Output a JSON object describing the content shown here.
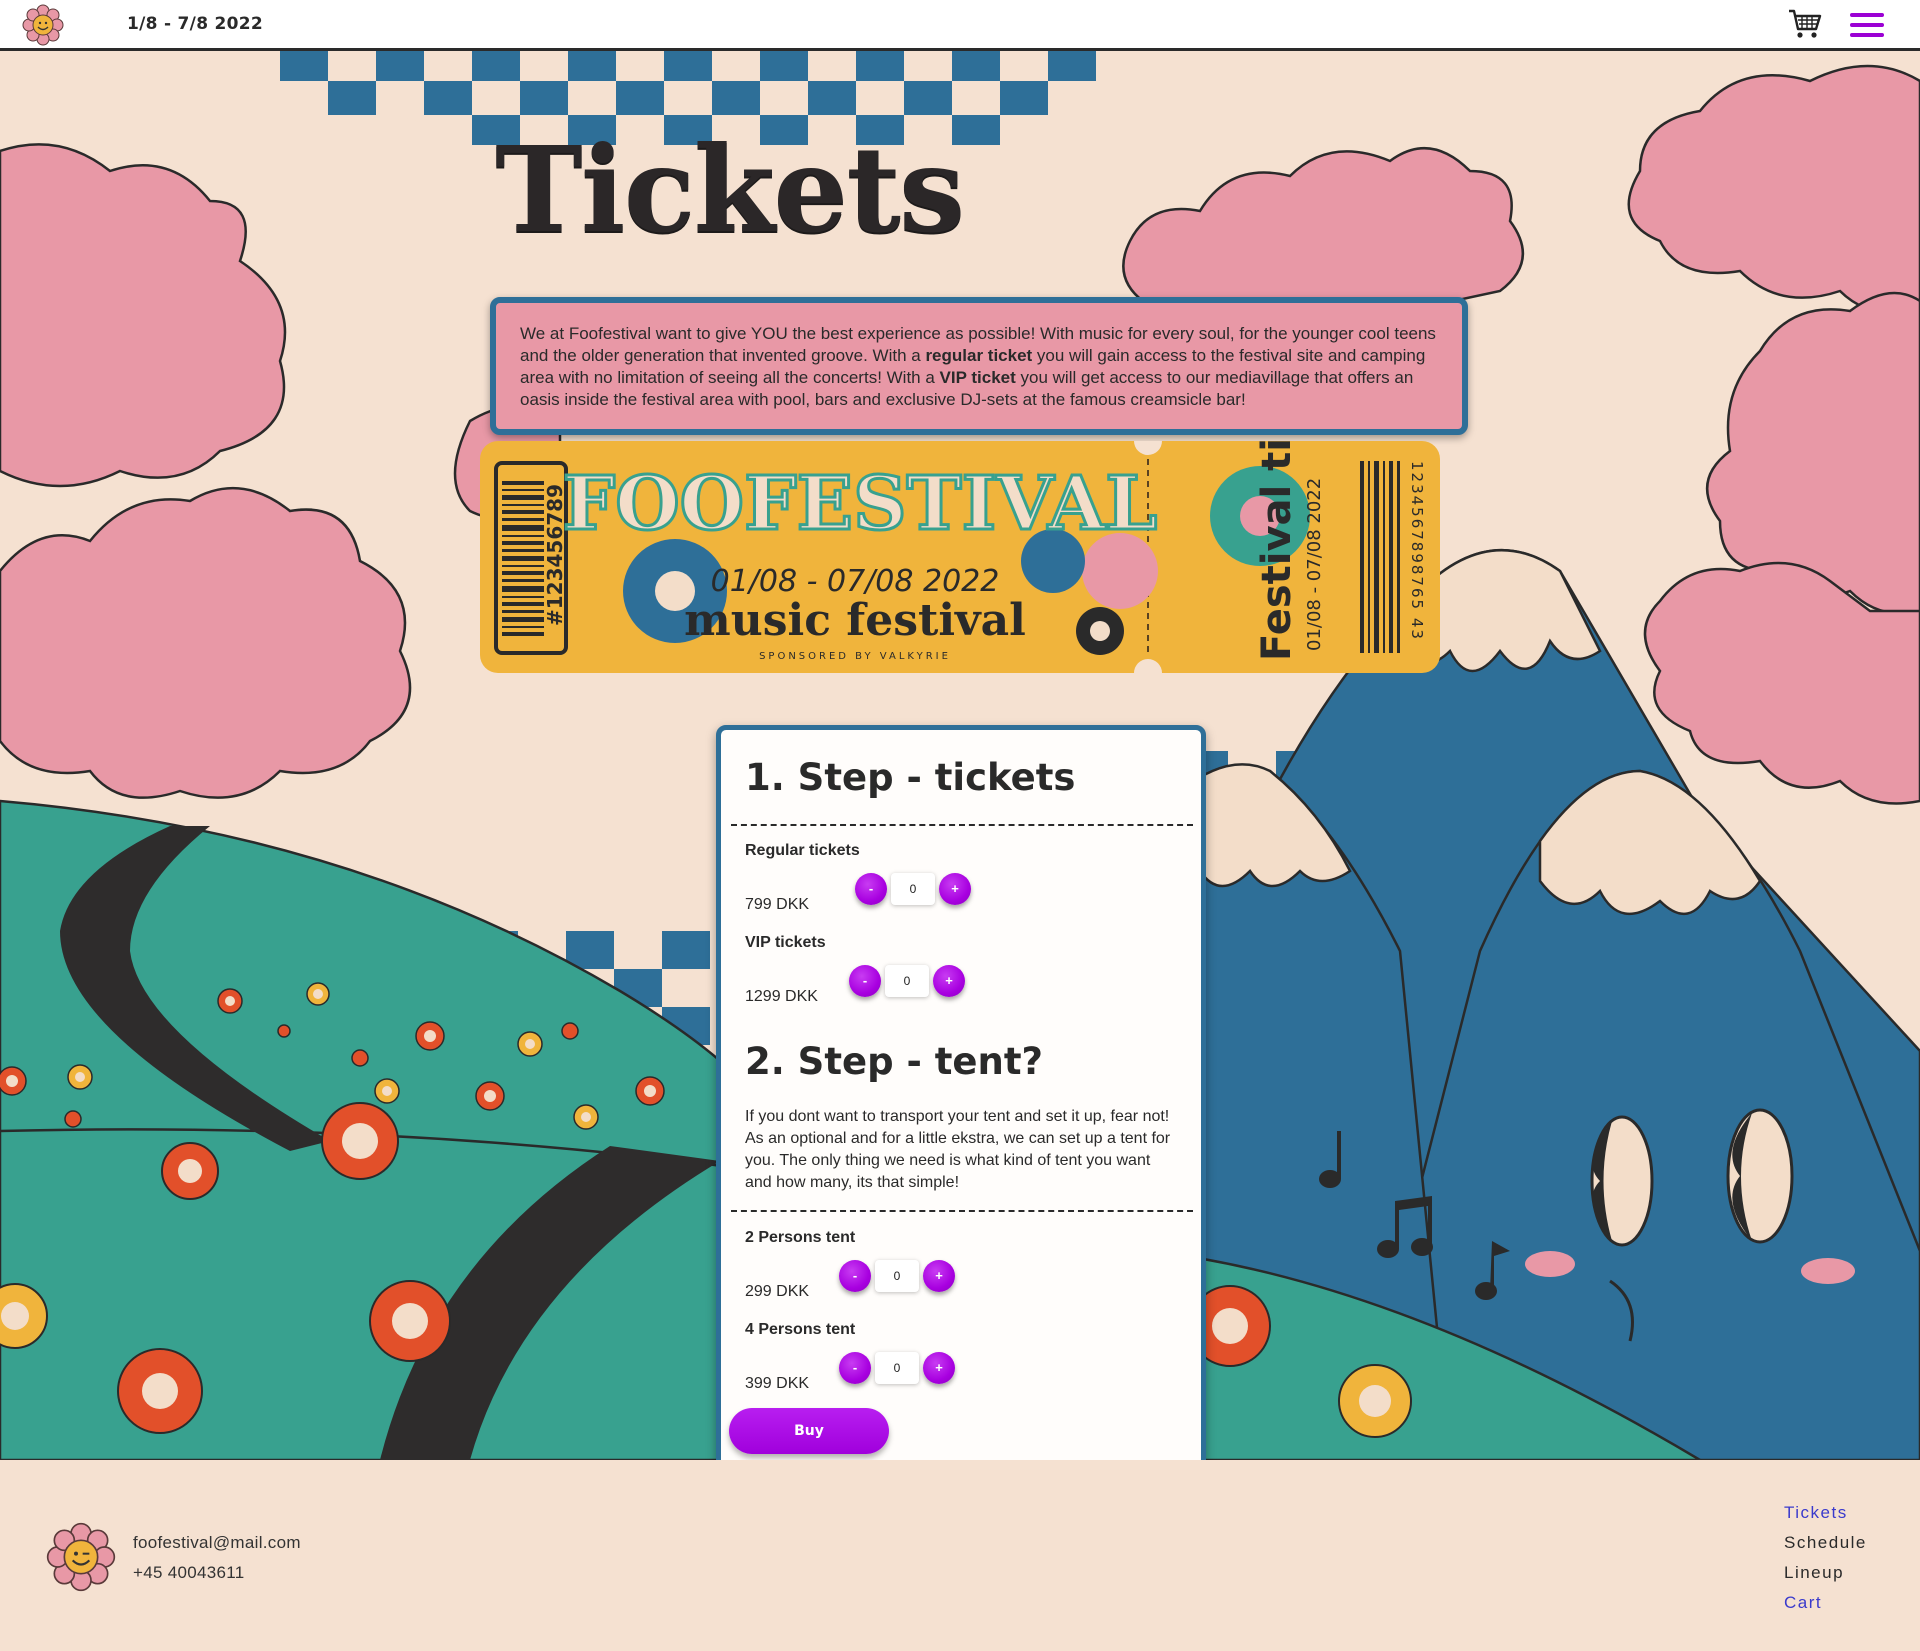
{
  "nav": {
    "dates": "1/8 - 7/8 2022",
    "logo_icon": "smiley-flower-icon",
    "cart_icon": "shopping-cart-icon",
    "menu_icon": "hamburger-menu-icon"
  },
  "page": {
    "title": "Tickets"
  },
  "intro": {
    "part1": "We at Foofestival want to give YOU the best experience as possible! With music for every soul, for the younger cool teens and the older generation that invented groove. With a ",
    "bold1": "regular ticket",
    "part2": " you will gain access to the festival site and camping area with no limitation of seeing all the concerts! With a ",
    "bold2": "VIP ticket",
    "part3": " you will get access to our mediavillage that offers an oasis inside the festival area with pool, bars and exclusive DJ-sets at the famous creamsicle bar!"
  },
  "ticket_graphic": {
    "stub_number": "#123456789",
    "festival_name": "FOOFESTIVAL",
    "dates": "01/08 - 07/08 2022",
    "subtitle": "music festival",
    "sponsor": "SPONSORED BY VALKYRIE",
    "side_title": "Festival ticket",
    "side_dates": "01/08 - 07/08 2022",
    "side_number": "1234567898765 43"
  },
  "step1": {
    "heading": "1. Step - tickets",
    "items": [
      {
        "label": "Regular tickets",
        "price": "799 DKK",
        "qty": "0"
      },
      {
        "label": "VIP tickets",
        "price": "1299 DKK",
        "qty": "0"
      }
    ]
  },
  "step2": {
    "heading": "2. Step - tent?",
    "text": "If you dont want to transport your tent and set it up, fear not! As an optional and for a little ekstra, we can set up a tent for you. The only thing we need is what kind of tent you want and how many, its that simple!",
    "items": [
      {
        "label": "2 Persons tent",
        "price": "299 DKK",
        "qty": "0"
      },
      {
        "label": "4 Persons tent",
        "price": "399 DKK",
        "qty": "0"
      }
    ]
  },
  "stepper": {
    "minus": "-",
    "plus": "+"
  },
  "buy_label": "Buy",
  "footer": {
    "email": "foofestival@mail.com",
    "phone": "+45 40043611",
    "links": [
      "Tickets",
      "Schedule",
      "Lineup",
      "Cart"
    ]
  },
  "colors": {
    "background": "#f5e1d1",
    "accent_purple": "#a800e0",
    "border_blue": "#2e6f98",
    "cloud_pink": "#e898a6",
    "hill_green": "#38a18f",
    "ticket_yellow": "#f0b43c"
  }
}
